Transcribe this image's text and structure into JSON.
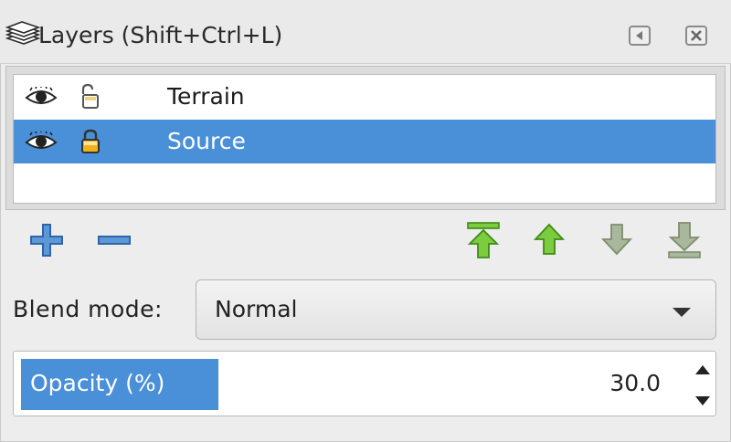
{
  "header": {
    "title": "Layers (Shift+Ctrl+L)"
  },
  "layers": [
    {
      "name": "Terrain",
      "visible": true,
      "locked": false,
      "selected": false
    },
    {
      "name": "Source",
      "visible": true,
      "locked": true,
      "selected": true
    }
  ],
  "toolbar": {
    "buttons": [
      "add-layer",
      "remove-layer",
      "raise-to-top",
      "raise",
      "lower",
      "lower-to-bottom"
    ]
  },
  "blend": {
    "label": "Blend mode:",
    "value": "Normal"
  },
  "opacity": {
    "label": "Opacity (%)",
    "value": "30.0",
    "percent": 30
  },
  "colors": {
    "selection": "#4a90d9",
    "add_remove": "#3f7cc2",
    "move_green": "#5cb82b",
    "move_disabled": "#8fa679"
  }
}
